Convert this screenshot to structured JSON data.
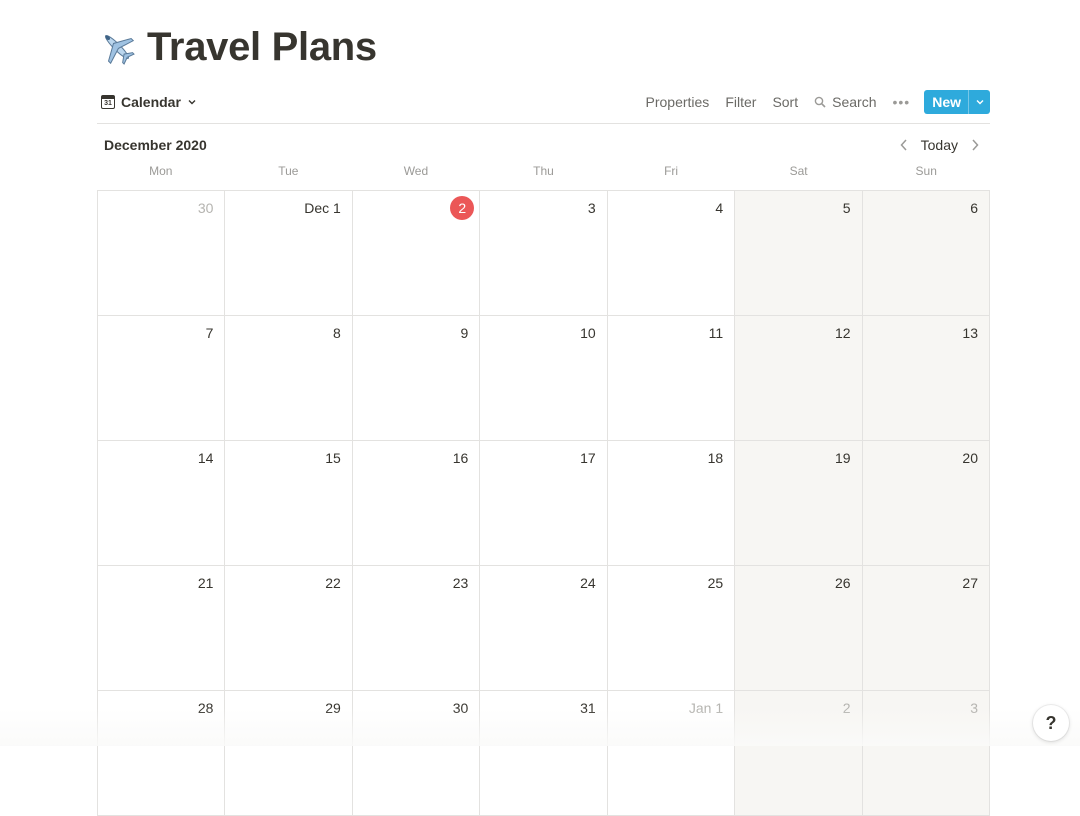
{
  "page": {
    "title": "Travel Plans",
    "title_icon": "airplane-emoji"
  },
  "toolbar": {
    "view_label": "Calendar",
    "properties_label": "Properties",
    "filter_label": "Filter",
    "sort_label": "Sort",
    "search_label": "Search",
    "more_label": "•••",
    "new_label": "New"
  },
  "calendar": {
    "month_title": "December 2020",
    "today_label": "Today",
    "weekdays": [
      "Mon",
      "Tue",
      "Wed",
      "Thu",
      "Fri",
      "Sat",
      "Sun"
    ],
    "weeks": [
      [
        {
          "label": "30",
          "other": true
        },
        {
          "label": "Dec 1"
        },
        {
          "label": "2",
          "today": true
        },
        {
          "label": "3"
        },
        {
          "label": "4"
        },
        {
          "label": "5"
        },
        {
          "label": "6"
        }
      ],
      [
        {
          "label": "7"
        },
        {
          "label": "8"
        },
        {
          "label": "9"
        },
        {
          "label": "10"
        },
        {
          "label": "11"
        },
        {
          "label": "12"
        },
        {
          "label": "13"
        }
      ],
      [
        {
          "label": "14"
        },
        {
          "label": "15"
        },
        {
          "label": "16"
        },
        {
          "label": "17"
        },
        {
          "label": "18"
        },
        {
          "label": "19"
        },
        {
          "label": "20"
        }
      ],
      [
        {
          "label": "21"
        },
        {
          "label": "22"
        },
        {
          "label": "23"
        },
        {
          "label": "24"
        },
        {
          "label": "25"
        },
        {
          "label": "26"
        },
        {
          "label": "27"
        }
      ],
      [
        {
          "label": "28"
        },
        {
          "label": "29"
        },
        {
          "label": "30"
        },
        {
          "label": "31"
        },
        {
          "label": "Jan 1",
          "other": true
        },
        {
          "label": "2",
          "other": true
        },
        {
          "label": "3",
          "other": true
        }
      ]
    ]
  },
  "help": {
    "label": "?"
  },
  "colors": {
    "accent": "#2eaadc",
    "today": "#eb5757",
    "weekend": "#f7f6f3",
    "text": "#37352f",
    "muted": "#9b9a97"
  }
}
